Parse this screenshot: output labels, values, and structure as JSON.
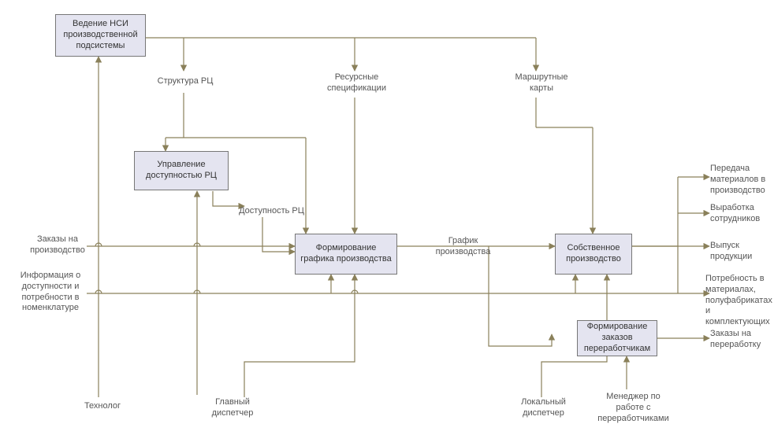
{
  "diagram": {
    "nodes": {
      "nsi": {
        "label": "Ведение НСИ производственной подсистемы"
      },
      "upr_rc": {
        "label": "Управление доступностью РЦ"
      },
      "form_graf": {
        "label": "Формирование графика производства"
      },
      "sobstv": {
        "label": "Собственное производство"
      },
      "form_zak": {
        "label": "Формирование заказов переработчикам"
      }
    },
    "labels": {
      "struct_rc": "Структура РЦ",
      "res_spec": "Ресурсные спецификации",
      "marsh_karty": "Маршрутные карты",
      "dostup_rc": "Доступность РЦ",
      "zakazy_proizv": "Заказы на производство",
      "info_dostup": "Информация о доступности и потребности в номенклатуре",
      "grafik": "График производства",
      "peredacha": "Передача материалов в производство",
      "vyrabotka": "Выработка сотрудников",
      "vypusk": "Выпуск продукции",
      "potrebnost": "Потребность в материалах, полуфабрикатах и комплектующих",
      "zakazy_pererab": "Заказы на переработку",
      "tekhnolog": "Технолог",
      "glav_disp": "Главный диспетчер",
      "lok_disp": "Локальный диспетчер",
      "menedzher": "Менеджер по работе с переработчиками"
    },
    "edges": [
      {
        "from": "nsi",
        "to_label": "struct_rc"
      },
      {
        "from": "nsi",
        "to_label": "res_spec"
      },
      {
        "from": "nsi",
        "to_label": "marsh_karty"
      },
      {
        "from_label": "struct_rc",
        "to": "upr_rc"
      },
      {
        "from_label": "struct_rc",
        "to": "form_graf"
      },
      {
        "from_label": "res_spec",
        "to": "form_graf"
      },
      {
        "from_label": "marsh_karty",
        "to": "sobstv"
      },
      {
        "from": "upr_rc",
        "to_label": "dostup_rc"
      },
      {
        "from_label": "dostup_rc",
        "to": "form_graf"
      },
      {
        "from_label": "zakazy_proizv",
        "to": "form_graf",
        "passes_through": [
          "upr_rc",
          "sobstv"
        ]
      },
      {
        "from_label": "info_dostup",
        "to": "form_graf"
      },
      {
        "from_label": "info_dostup",
        "to": "sobstv"
      },
      {
        "from": "form_graf",
        "to_label": "grafik"
      },
      {
        "from_label": "grafik",
        "to": "sobstv"
      },
      {
        "from_label": "grafik",
        "to": "form_zak"
      },
      {
        "from": "sobstv",
        "to_label": "peredacha"
      },
      {
        "from": "sobstv",
        "to_label": "vyrabotka"
      },
      {
        "from": "sobstv",
        "to_label": "vypusk"
      },
      {
        "from": "sobstv",
        "to_label": "potrebnost"
      },
      {
        "from": "form_zak",
        "to_label": "zakazy_pererab"
      },
      {
        "from_label": "tekhnolog",
        "to": "nsi"
      },
      {
        "from_label": "glav_disp",
        "to": "upr_rc"
      },
      {
        "from_label": "glav_disp",
        "to": "form_graf"
      },
      {
        "from_label": "lok_disp",
        "to": "sobstv"
      },
      {
        "from_label": "menedzher",
        "to": "form_zak"
      }
    ]
  }
}
